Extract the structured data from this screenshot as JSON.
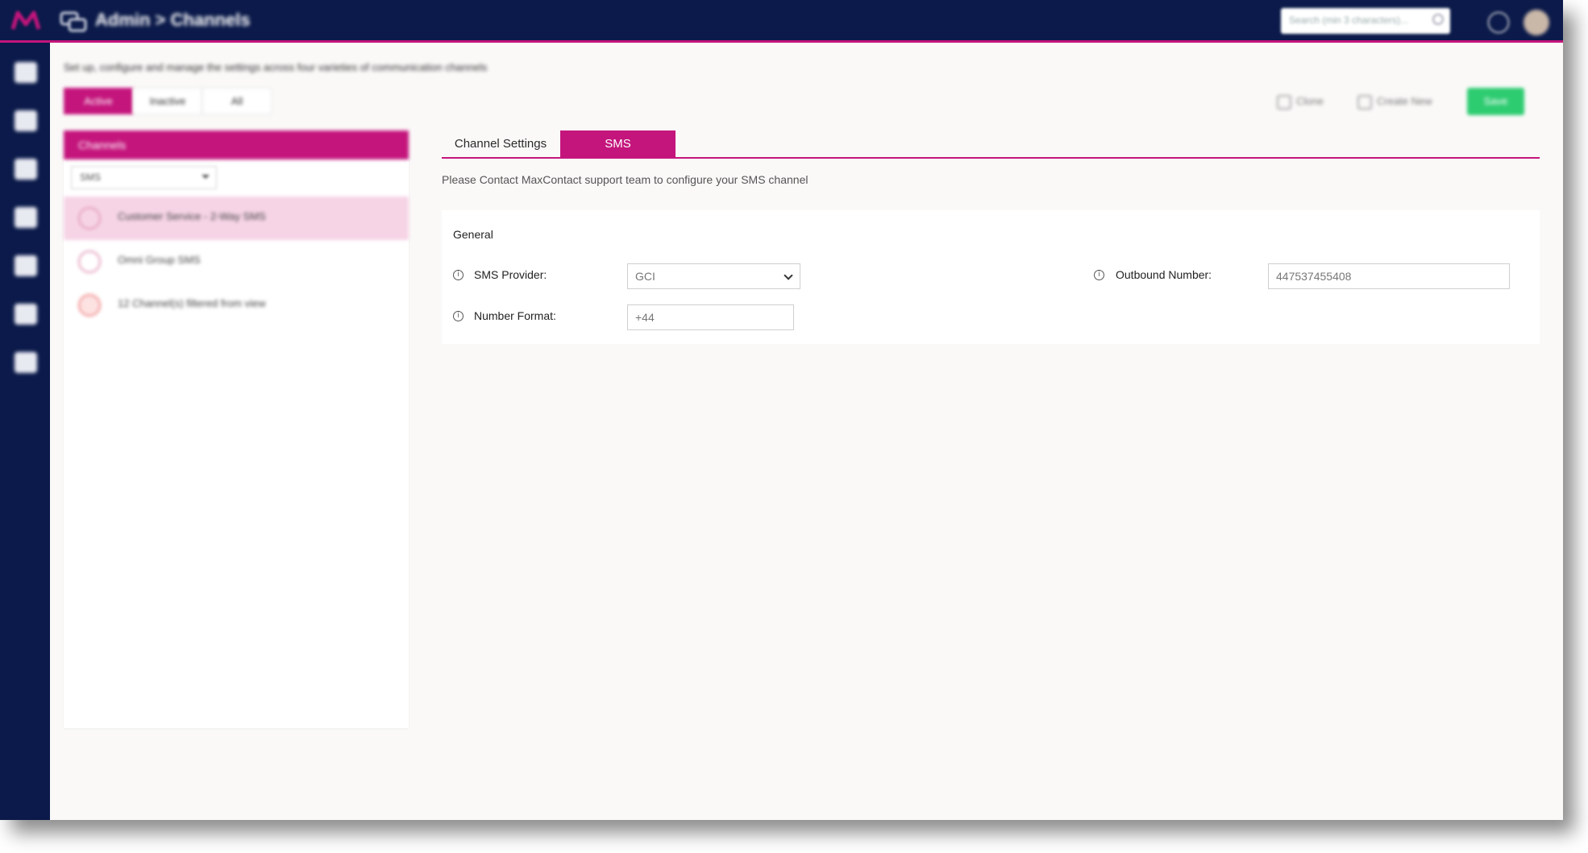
{
  "header": {
    "breadcrumb": "Admin > Channels",
    "search_placeholder": "Search (min 3 characters)..."
  },
  "intro_text": "Set up, configure and manage the settings across four varieties of communication channels",
  "filter_tabs": [
    {
      "label": "Active",
      "active": true
    },
    {
      "label": "Inactive",
      "active": false
    },
    {
      "label": "All",
      "active": false
    }
  ],
  "toolbar": {
    "clone_label": "Clone",
    "create_new_label": "Create New",
    "save_label": "Save"
  },
  "channels_panel": {
    "title": "Channels",
    "type_filter": "SMS",
    "items": [
      {
        "label": "Customer Service - 2-Way SMS",
        "selected": true
      },
      {
        "label": "Omni Group SMS",
        "selected": false
      },
      {
        "label": "12  Channel(s) filtered from view",
        "selected": false
      }
    ]
  },
  "tabs": [
    {
      "label": "Channel Settings",
      "active": false
    },
    {
      "label": "SMS",
      "active": true
    }
  ],
  "notice": "Please Contact MaxContact support team to configure your SMS channel",
  "general": {
    "title": "General",
    "sms_provider_label": "SMS Provider:",
    "sms_provider_value": "GCI",
    "outbound_number_label": "Outbound Number:",
    "outbound_number_value": "447537455408",
    "number_format_label": "Number Format:",
    "number_format_value": "+44"
  },
  "colors": {
    "brand_pink": "#c4157c",
    "nav_navy": "#0b1a4a",
    "save_green": "#2ecc71"
  }
}
